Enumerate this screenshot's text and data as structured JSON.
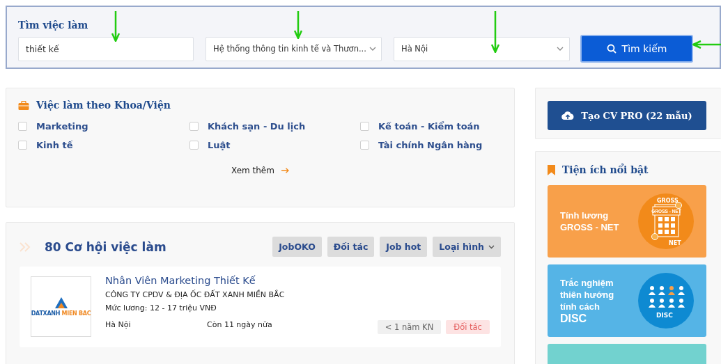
{
  "search": {
    "title": "Tìm việc làm",
    "keyword": "thiết kế",
    "faculty": "Hệ thống thông tin kinh tế và Thươn...",
    "location": "Hà Nội",
    "button": "Tìm kiếm"
  },
  "faculty_section": {
    "title": "Việc làm theo Khoa/Viện",
    "items": [
      {
        "label": "Marketing",
        "checked": false
      },
      {
        "label": "Khách sạn - Du lịch",
        "checked": false
      },
      {
        "label": "Kế toán - Kiểm toán",
        "checked": false
      },
      {
        "label": "Kinh tế",
        "checked": false
      },
      {
        "label": "Luật",
        "checked": false
      },
      {
        "label": "Tài chính Ngân hàng",
        "checked": false
      }
    ],
    "more_link": "Xem thêm"
  },
  "jobs": {
    "title": "80 Cơ hội việc làm",
    "filters": [
      {
        "label": "JobOKO",
        "kind": "button"
      },
      {
        "label": "Đối tác",
        "kind": "button"
      },
      {
        "label": "Job hot",
        "kind": "button"
      },
      {
        "label": "Loại hình",
        "kind": "dropdown"
      }
    ],
    "listings": [
      {
        "title": "Nhân Viên Marketing Thiết Kế",
        "company": "CÔNG TY CPDV & ĐỊA ỐC ĐẤT XANH MIỀN BẮC",
        "salary": "Mức lương: 12 - 17 triệu VNĐ",
        "location": "Hà Nội",
        "deadline": "Còn 11 ngày nữa",
        "logo": {
          "text_1": "DATXANH",
          "text_2": "MIEN BAC"
        },
        "tags": [
          {
            "label": "< 1 năm KN",
            "kind": "experience"
          },
          {
            "label": "Đối tác",
            "kind": "partner"
          }
        ]
      }
    ]
  },
  "sidebar": {
    "cv_button": "Tạo CV PRO (22 mẫu)",
    "utilities_title": "Tiện ích nổi bật",
    "tiles": [
      {
        "kind": "salary",
        "color": "#f8a04a",
        "lines": [
          "Tính lương",
          "GROSS - NET"
        ],
        "art_labels": [
          "GROSS",
          "GROSS - NET",
          "NET"
        ]
      },
      {
        "kind": "disc",
        "color": "#55b4e6",
        "lines": [
          "Trắc nghiệm",
          "thiên hướng",
          "tính cách"
        ],
        "highlight": "DISC",
        "art_labels": [
          "DISC"
        ]
      },
      {
        "kind": "blank",
        "color": "#72d2cf"
      }
    ]
  },
  "annotation_arrows": [
    {
      "kind": "down"
    },
    {
      "kind": "down"
    },
    {
      "kind": "down"
    },
    {
      "kind": "left"
    }
  ]
}
